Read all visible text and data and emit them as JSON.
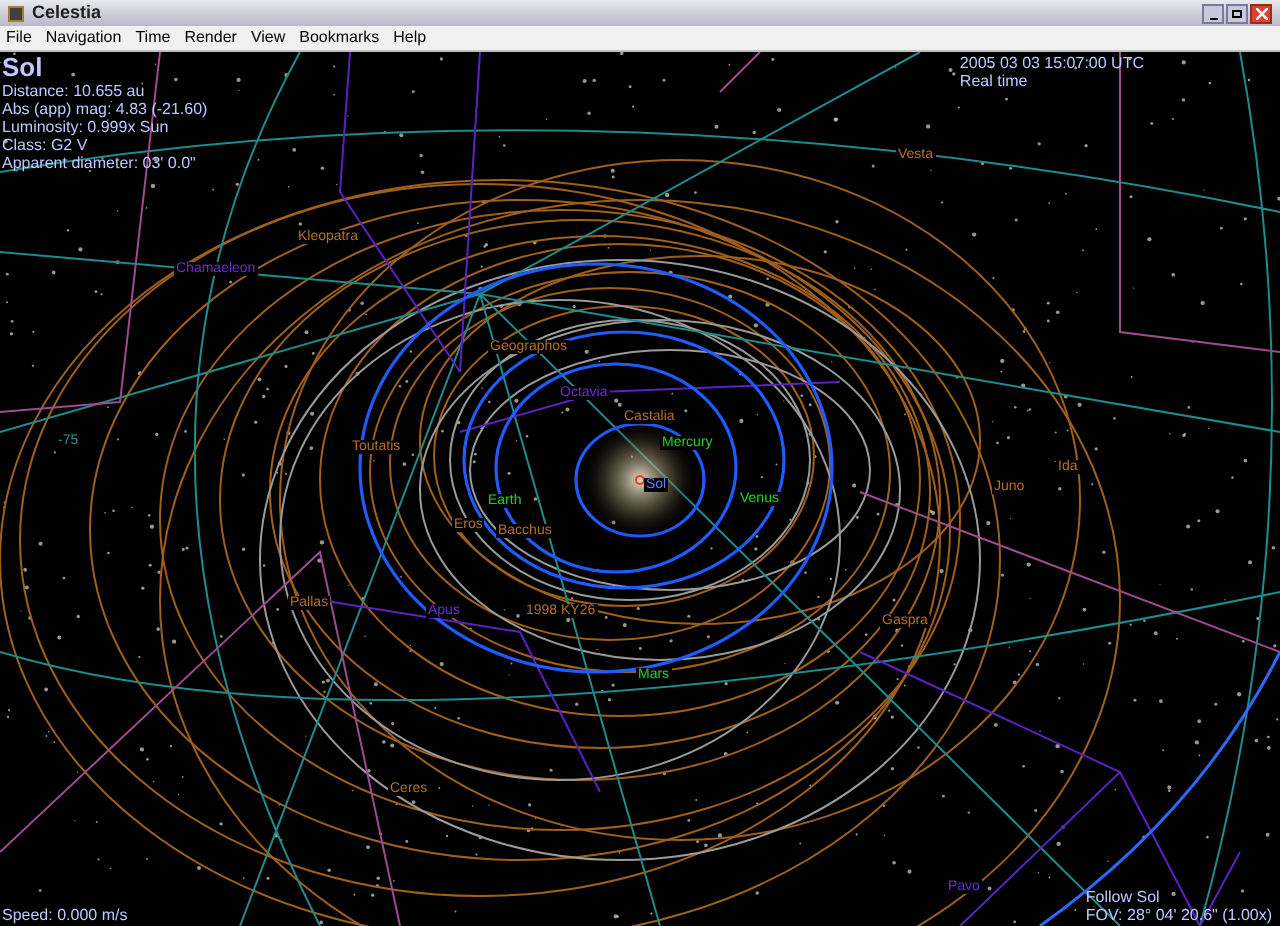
{
  "window": {
    "title": "Celestia"
  },
  "menu": [
    "File",
    "Navigation",
    "Time",
    "Render",
    "View",
    "Bookmarks",
    "Help"
  ],
  "info": {
    "name": "Sol",
    "lines": [
      "Distance: 10.655 au",
      "Abs (app) mag: 4.83 (-21.60)",
      "Luminosity: 0.999x Sun",
      "Class: G2 V",
      "Apparent diameter: 03' 0.0\""
    ]
  },
  "time": {
    "date": "2005 03 03 15:07:00 UTC",
    "mode": "Real time"
  },
  "labels": [
    {
      "text": "Vesta",
      "kind": "asteroid"
    },
    {
      "text": "Kleopatra",
      "kind": "asteroid"
    },
    {
      "text": "Chamaeleon",
      "kind": "constellation"
    },
    {
      "text": "Geographos",
      "kind": "asteroid"
    },
    {
      "text": "Octavia",
      "kind": "constellation"
    },
    {
      "text": "Castalia",
      "kind": "asteroid"
    },
    {
      "text": "Toutatis",
      "kind": "asteroid"
    },
    {
      "text": "-75",
      "kind": "grid"
    },
    {
      "text": "Mercury",
      "kind": "planet"
    },
    {
      "text": "Ida",
      "kind": "asteroid"
    },
    {
      "text": "Sol",
      "kind": "star"
    },
    {
      "text": "Juno",
      "kind": "asteroid"
    },
    {
      "text": "Earth",
      "kind": "planet"
    },
    {
      "text": "Venus",
      "kind": "planet"
    },
    {
      "text": "Eros",
      "kind": "asteroid"
    },
    {
      "text": "Bacchus",
      "kind": "asteroid"
    },
    {
      "text": "Pallas",
      "kind": "asteroid"
    },
    {
      "text": "Apus",
      "kind": "constellation"
    },
    {
      "text": "1998 KY26",
      "kind": "asteroid"
    },
    {
      "text": "Gaspra",
      "kind": "asteroid"
    },
    {
      "text": "Mars",
      "kind": "planet"
    },
    {
      "text": "Ceres",
      "kind": "asteroid"
    },
    {
      "text": "Pavo",
      "kind": "constellation"
    }
  ],
  "status": {
    "speed": "Speed: 0.000 m/s",
    "follow": "Follow Sol",
    "fov": "FOV: 28° 04' 20.6\" (1.00x)"
  }
}
